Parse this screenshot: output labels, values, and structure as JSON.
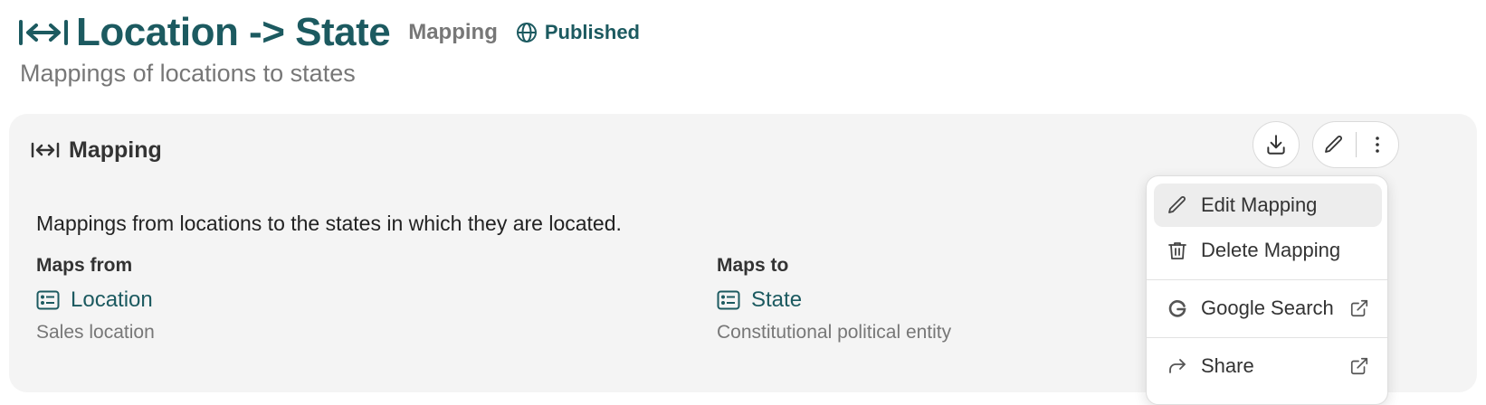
{
  "header": {
    "title": "Location -> State",
    "type_label": "Mapping",
    "status": "Published"
  },
  "subtitle": "Mappings of locations to states",
  "card": {
    "title": "Mapping",
    "description": "Mappings from locations to the states in which they are located.",
    "from": {
      "label": "Maps from",
      "entity": "Location",
      "note": "Sales location"
    },
    "to": {
      "label": "Maps to",
      "entity": "State",
      "note": "Constitutional political entity"
    }
  },
  "menu": {
    "items": [
      {
        "label": "Edit Mapping",
        "icon": "pencil-icon"
      },
      {
        "label": "Delete Mapping",
        "icon": "trash-icon"
      },
      {
        "label": "Google Search",
        "icon": "google-icon"
      },
      {
        "label": "Share",
        "icon": "share-icon"
      }
    ]
  },
  "colors": {
    "accent": "#1c5a60",
    "card_bg": "#f4f4f4",
    "muted_text": "#777777"
  }
}
